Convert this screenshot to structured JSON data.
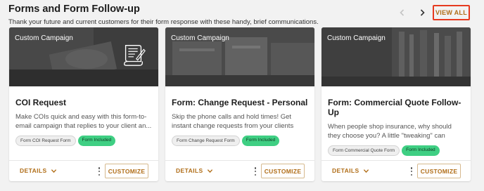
{
  "section": {
    "title": "Forms and Form Follow-up",
    "subtitle": "Thank your future and current customers for their form response with these handy, brief communications.",
    "view_all_label": "VIEW ALL"
  },
  "icons": {
    "prev": "chevron-left-icon",
    "next": "chevron-right-icon",
    "document": "document-signature-icon",
    "expand": "chevron-down-icon",
    "menu": "more-vertical-icon"
  },
  "colors": {
    "accent": "#b06d17",
    "highlight_border": "#e63a1f",
    "tag_green": "#3fcf83"
  },
  "cards": [
    {
      "banner_label": "Custom Campaign",
      "title": "COI Request",
      "description": "Make COIs quick and easy with this form-to-email campaign that replies to your client an...",
      "form_tag": "Form COI Request Form",
      "included_tag": "Form Included",
      "details_label": "DETAILS",
      "customize_label": "CUSTOMIZE"
    },
    {
      "banner_label": "Custom Campaign",
      "title": "Form: Change Request - Personal",
      "description": "Skip the phone calls and hold times! Get instant change requests from your clients wit...",
      "form_tag": "Form Change Request Form",
      "included_tag": "Form Included",
      "details_label": "DETAILS",
      "customize_label": "CUSTOMIZE"
    },
    {
      "banner_label": "Custom Campaign",
      "title": "Form: Commercial Quote Follow-Up",
      "description": "When people shop insurance, why should they choose you? A little \"tweaking\" can really...",
      "form_tag": "Form Commercial Quote Form",
      "included_tag": "Form Included",
      "details_label": "DETAILS",
      "customize_label": "CUSTOMIZE"
    }
  ]
}
